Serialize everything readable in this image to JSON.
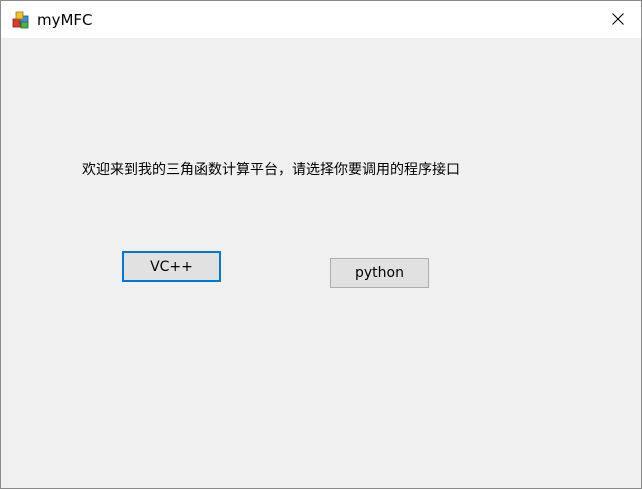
{
  "window": {
    "title": "myMFC",
    "app_icon": "mfc-app-icon",
    "close_icon": "close-icon"
  },
  "main": {
    "welcome_text": "欢迎来到我的三角函数计算平台，请选择你要调用的程序接口",
    "vc_button_label": "VC++",
    "python_button_label": "python"
  }
}
